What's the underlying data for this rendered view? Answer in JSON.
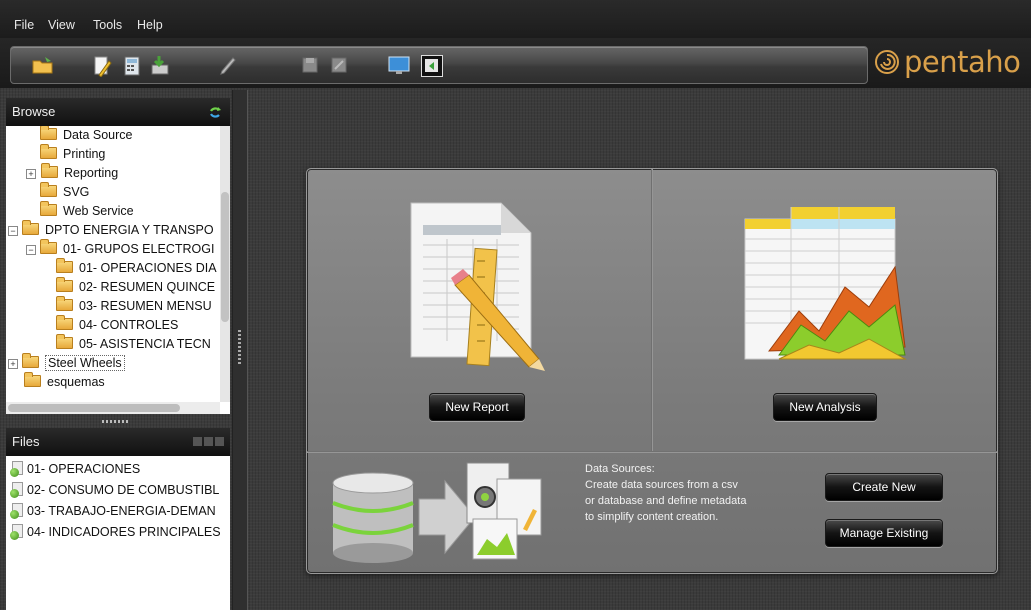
{
  "menu": [
    "File",
    "View",
    "Tools",
    "Help"
  ],
  "logo_text": "pentaho",
  "toolbar_icons": [
    "open-folder-icon",
    "new-report-icon",
    "calculator-icon",
    "publish-icon",
    "pencil-icon",
    "save-icon",
    "save-as-icon",
    "monitor-icon",
    "refresh-panel-icon"
  ],
  "browse": {
    "title": "Browse",
    "items": [
      {
        "label": "Data Source",
        "level": 2,
        "expander": ""
      },
      {
        "label": "Printing",
        "level": 2,
        "expander": ""
      },
      {
        "label": "Reporting",
        "level": 2,
        "expander": "+"
      },
      {
        "label": "SVG",
        "level": 2,
        "expander": ""
      },
      {
        "label": "Web Service",
        "level": 2,
        "expander": ""
      },
      {
        "label": "DPTO ENERGIA Y TRANSPO",
        "level": 0,
        "expander": "−"
      },
      {
        "label": "01- GRUPOS ELECTROGI",
        "level": 1,
        "expander": "−"
      },
      {
        "label": "01- OPERACIONES DIA",
        "level": 3,
        "expander": ""
      },
      {
        "label": "02- RESUMEN QUINCE",
        "level": 3,
        "expander": ""
      },
      {
        "label": "03- RESUMEN MENSU",
        "level": 3,
        "expander": ""
      },
      {
        "label": "04- CONTROLES",
        "level": 3,
        "expander": ""
      },
      {
        "label": "05- ASISTENCIA TECN",
        "level": 3,
        "expander": ""
      },
      {
        "label": "Steel Wheels",
        "level": 0,
        "expander": "+",
        "selected": true
      },
      {
        "label": "esquemas",
        "level": 0,
        "expander": ""
      }
    ]
  },
  "files": {
    "title": "Files",
    "items": [
      "01- OPERACIONES",
      "02- CONSUMO DE COMBUSTIBL",
      "03- TRABAJO-ENERGIA-DEMAN",
      "04- INDICADORES PRINCIPALES"
    ]
  },
  "main": {
    "new_report_label": "New Report",
    "new_analysis_label": "New Analysis",
    "ds_title": "Data Sources:",
    "ds_description": [
      "Create data sources from a csv",
      "or database and define metadata",
      "to simplify content creation."
    ],
    "create_new_label": "Create New",
    "manage_existing_label": "Manage Existing"
  },
  "colors": {
    "logo": "#d9a04a",
    "folder": "#f3c55d",
    "accent_green": "#8fc02e"
  }
}
